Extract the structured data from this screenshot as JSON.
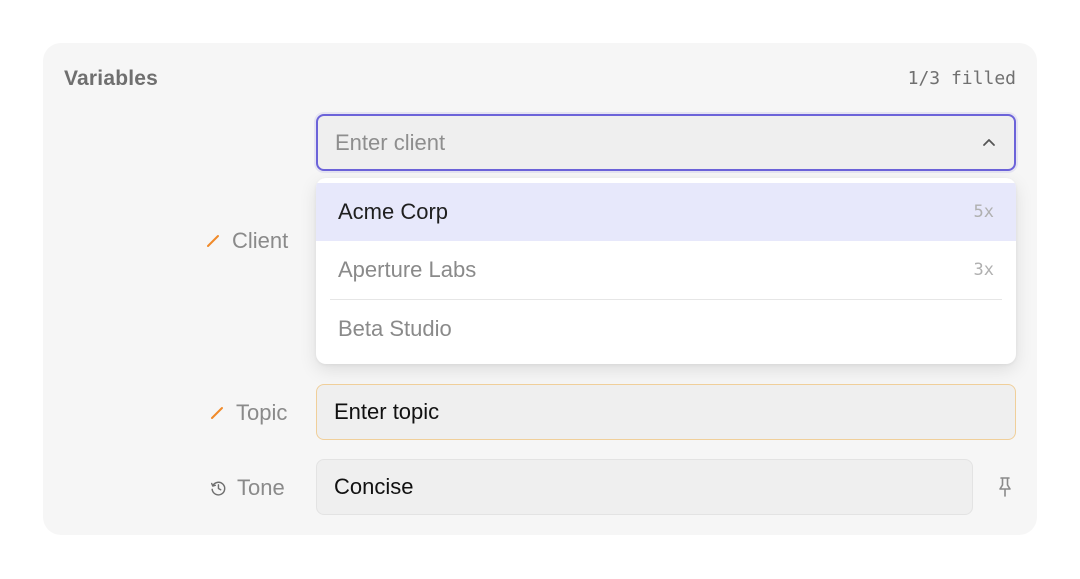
{
  "panel": {
    "title": "Variables",
    "filled_count": "1/3 filled"
  },
  "fields": {
    "client": {
      "label": "Client",
      "placeholder": "Enter client",
      "icon": "pencil-icon",
      "icon_color": "#f08a2a"
    },
    "topic": {
      "label": "Topic",
      "placeholder": "Enter topic",
      "icon": "pencil-icon",
      "icon_color": "#f08a2a"
    },
    "tone": {
      "label": "Tone",
      "value": "Concise",
      "icon": "history-icon",
      "action_icon": "pin-icon"
    }
  },
  "dropdown": {
    "options": [
      {
        "label": "Acme Corp",
        "count": "5x"
      },
      {
        "label": "Aperture Labs",
        "count": "3x"
      },
      {
        "label": "Beta Studio",
        "count": ""
      }
    ]
  },
  "colors": {
    "accent": "#6c63d9",
    "highlight": "#e7e8fb",
    "warning_border": "#f0cf9a"
  }
}
